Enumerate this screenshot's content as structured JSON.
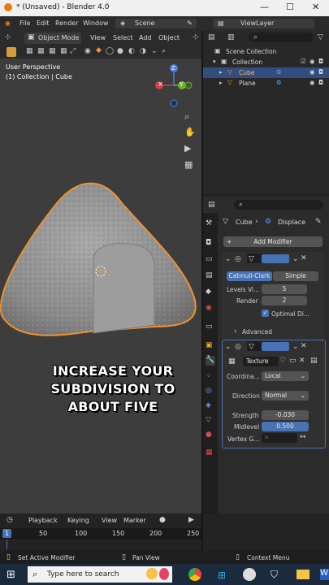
{
  "window": {
    "title": "* (Unsaved) - Blender 4.0",
    "minimize": "—",
    "maximize": "☐",
    "close": "✕"
  },
  "menu": {
    "items": [
      "File",
      "Edit",
      "Render",
      "Window"
    ],
    "scene": "Scene",
    "view_layer": "ViewLayer"
  },
  "viewport": {
    "mode": "Object Mode",
    "menus": [
      "View",
      "Select",
      "Add",
      "Object"
    ],
    "overlay_line1": "User Perspective",
    "overlay_line2": "(1) Collection | Cube",
    "axes": {
      "x": "X",
      "y": "Y",
      "z": "Z"
    },
    "caption": "INCREASE YOUR SUBDIVISION TO ABOUT FIVE"
  },
  "outliner": {
    "rows": [
      "Scene Collection",
      "Collection",
      "Cube",
      "Plane"
    ]
  },
  "properties": {
    "breadcrumb_obj": "Cube",
    "breadcrumb_mod": "Displace",
    "add_modifier": "Add Modifier",
    "subdiv": {
      "catmull": "Catmull-Clark",
      "simple": "Simple",
      "levels_label": "Levels Vi...",
      "levels_value": "5",
      "render_label": "Render",
      "render_value": "2",
      "optimal_label": "Optimal Di...",
      "advanced": "Advanced"
    },
    "displace": {
      "texture": "Texture",
      "coord_label": "Coordina...",
      "coord_value": "Local",
      "dir_label": "Direction",
      "dir_value": "Normal",
      "strength_label": "Strength",
      "strength_value": "-0.030",
      "midlevel_label": "Midlevel",
      "midlevel_value": "0.500",
      "vertex_label": "Vertex G..."
    }
  },
  "timeline": {
    "menus": [
      "Playback",
      "Keying",
      "View",
      "Marker"
    ],
    "frame": "1",
    "ticks": [
      "50",
      "100",
      "150",
      "200",
      "250"
    ]
  },
  "status": {
    "left": "Set Active Modifier",
    "mid": "Pan View",
    "right": "Context Menu"
  },
  "taskbar": {
    "search": "Type here to search"
  }
}
